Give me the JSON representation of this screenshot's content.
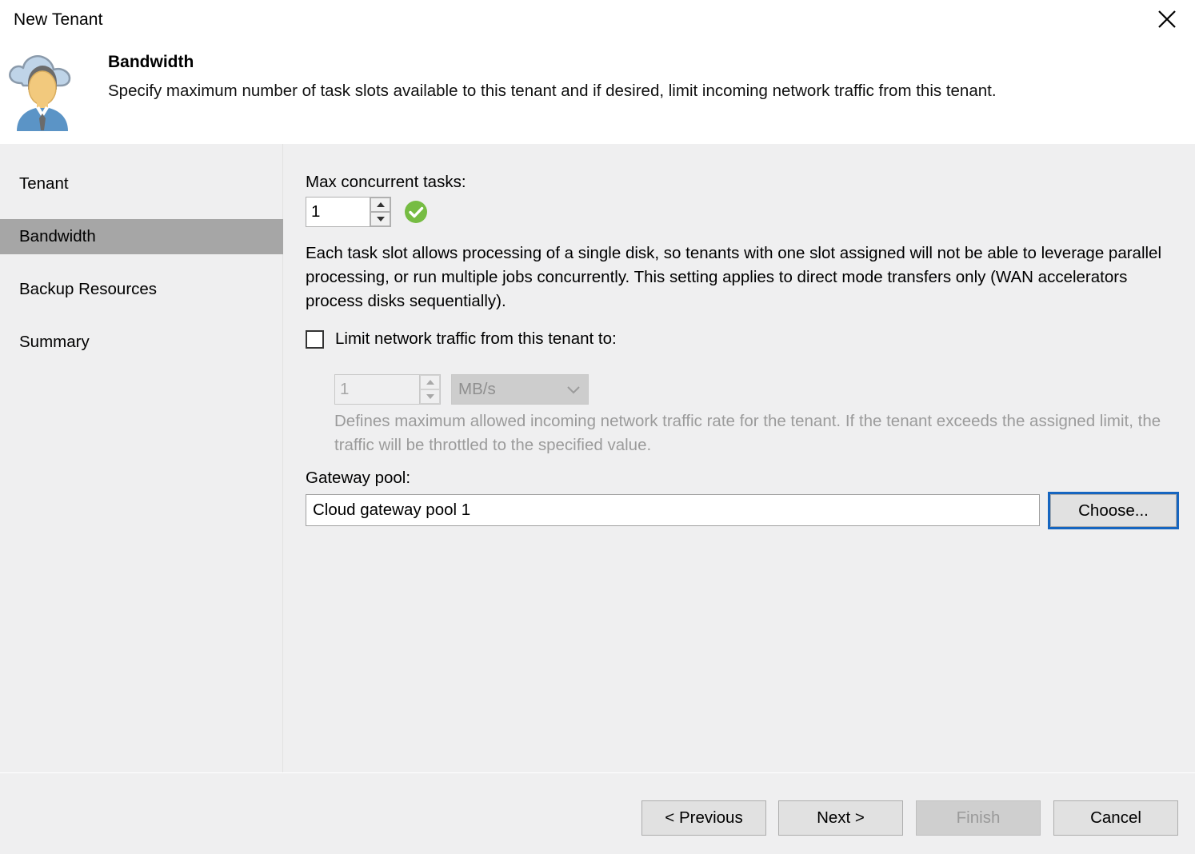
{
  "window": {
    "title": "New Tenant",
    "close_icon": "close-icon"
  },
  "header": {
    "icon": "cloud-tenant-user-icon",
    "title": "Bandwidth",
    "subtitle": "Specify maximum number of task slots available to this tenant and if desired, limit incoming network traffic from this tenant."
  },
  "sidebar": {
    "items": [
      {
        "label": "Tenant",
        "active": false
      },
      {
        "label": "Bandwidth",
        "active": true
      },
      {
        "label": "Backup Resources",
        "active": false
      },
      {
        "label": "Summary",
        "active": false
      }
    ]
  },
  "main": {
    "max_tasks": {
      "label": "Max concurrent tasks:",
      "value": "1",
      "validation_icon": "green-check-icon",
      "description": "Each task slot allows processing of a single disk, so tenants with one slot assigned will not be able to leverage parallel processing, or run multiple jobs concurrently. This setting applies to direct mode transfers only (WAN accelerators process disks sequentially)."
    },
    "limit_traffic": {
      "checkbox_label": "Limit network traffic from this tenant to:",
      "checked": false,
      "value": "1",
      "unit": "MB/s",
      "unit_chevron_icon": "chevron-down-icon",
      "description": "Defines maximum allowed incoming network traffic rate for the tenant.  If the tenant exceeds the assigned limit, the traffic will be throttled to the specified value."
    },
    "gateway_pool": {
      "label": "Gateway pool:",
      "value": "Cloud gateway pool 1",
      "choose_label": "Choose..."
    }
  },
  "footer": {
    "buttons": [
      {
        "label": "< Previous",
        "disabled": false
      },
      {
        "label": "Next >",
        "disabled": false
      },
      {
        "label": "Finish",
        "disabled": true
      },
      {
        "label": "Cancel",
        "disabled": false
      }
    ]
  },
  "colors": {
    "accent_blue": "#1565c0",
    "highlight_gray": "#a6a6a6",
    "body_bg": "#efeff0",
    "valid_green": "#76bc43"
  }
}
